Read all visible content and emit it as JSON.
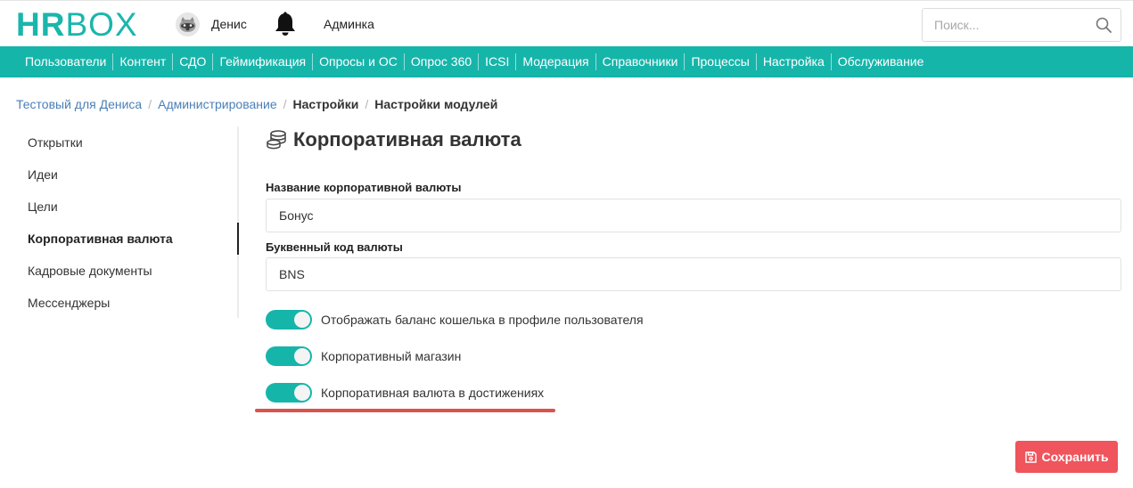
{
  "header": {
    "logo_hr": "HR",
    "logo_box": "BOX",
    "user_name": "Денис",
    "avatar_icon": "raccoon-avatar-icon",
    "bell_icon": "bell-icon",
    "admin_link": "Админка",
    "search_placeholder": "Поиск...",
    "search_icon": "search-icon"
  },
  "nav": {
    "items": [
      "Пользователи",
      "Контент",
      "СДО",
      "Геймификация",
      "Опросы и ОС",
      "Опрос 360",
      "ICSI",
      "Модерация",
      "Справочники",
      "Процессы",
      "Настройка",
      "Обслуживание"
    ]
  },
  "breadcrumb": {
    "items": [
      "Тестовый для Дениса",
      "Администрирование",
      "Настройки",
      "Настройки модулей"
    ],
    "separator": "/"
  },
  "sidebar": {
    "items": [
      "Открытки",
      "Идеи",
      "Цели",
      "Корпоративная валюта",
      "Кадровые документы",
      "Мессенджеры"
    ],
    "active": "Корпоративная валюта"
  },
  "main": {
    "title": "Корпоративная валюта",
    "title_icon": "coins-icon",
    "currency_name_label": "Название корпоративной валюты",
    "currency_name_value": "Бонус",
    "currency_code_label": "Буквенный код валюты",
    "currency_code_value": "BNS",
    "toggles": [
      {
        "label": "Отображать баланс кошелька в профиле пользователя",
        "on": true
      },
      {
        "label": "Корпоративный магазин",
        "on": true
      },
      {
        "label": "Корпоративная валюта в достижениях",
        "on": true
      }
    ]
  },
  "save_button": {
    "label": "Сохранить",
    "icon": "floppy-disk-icon"
  },
  "colors": {
    "brand": "#16b5aa",
    "link": "#4a7fb8",
    "save": "#f0545c",
    "highlight": "#d9534f"
  }
}
